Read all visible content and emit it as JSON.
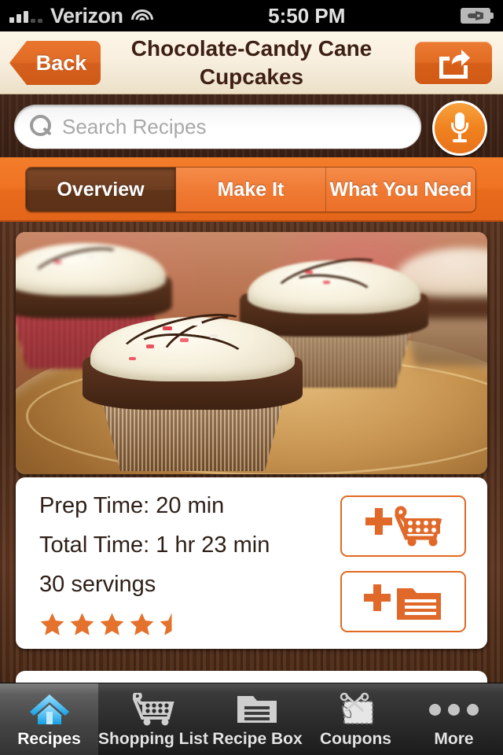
{
  "status_bar": {
    "carrier": "Verizon",
    "time": "5:50 PM",
    "signal_bars_filled": 3,
    "signal_bars_total": 5,
    "wifi": "wifi-icon",
    "battery": "battery-charging-icon"
  },
  "navbar": {
    "back_label": "Back",
    "title_line1": "Chocolate-Candy Cane",
    "title_line2": "Cupcakes",
    "share_icon": "share-icon"
  },
  "search": {
    "placeholder": "Search Recipes",
    "value": "",
    "search_icon": "search-icon",
    "mic_icon": "microphone-icon"
  },
  "segments": {
    "selected": "Overview",
    "items": [
      {
        "label": "Overview",
        "active": true
      },
      {
        "label": "Make It",
        "active": false
      },
      {
        "label": "What You Need",
        "active": false
      }
    ]
  },
  "recipe": {
    "photo_alt": "chocolate candy cane cupcakes on a wooden plate",
    "prep_time": "Prep Time:  20 min",
    "total_time": "Total Time:  1 hr 23 min",
    "servings": "30 servings",
    "rating": 4.5,
    "rating_max": 5,
    "add_to_shopping_list_icon": "add-to-cart-icon",
    "add_to_recipe_box_icon": "add-to-recipe-box-icon"
  },
  "tabbar": {
    "items": [
      {
        "label": "Recipes",
        "icon": "home-icon",
        "active": true
      },
      {
        "label": "Shopping List",
        "icon": "shopping-cart-icon",
        "active": false
      },
      {
        "label": "Recipe Box",
        "icon": "folder-icon",
        "active": false
      },
      {
        "label": "Coupons",
        "icon": "coupon-scissors-icon",
        "active": false
      },
      {
        "label": "More",
        "icon": "ellipsis-icon",
        "active": false
      }
    ]
  },
  "colors": {
    "accent_orange": "#e06a22",
    "tab_orange": "#ef7322",
    "selected_segment_brown": "#6d3c1f",
    "wood_brown": "#4e2c1a",
    "navbar_cream": "#f8efe0",
    "active_tab_blue": "#4db8f0"
  }
}
